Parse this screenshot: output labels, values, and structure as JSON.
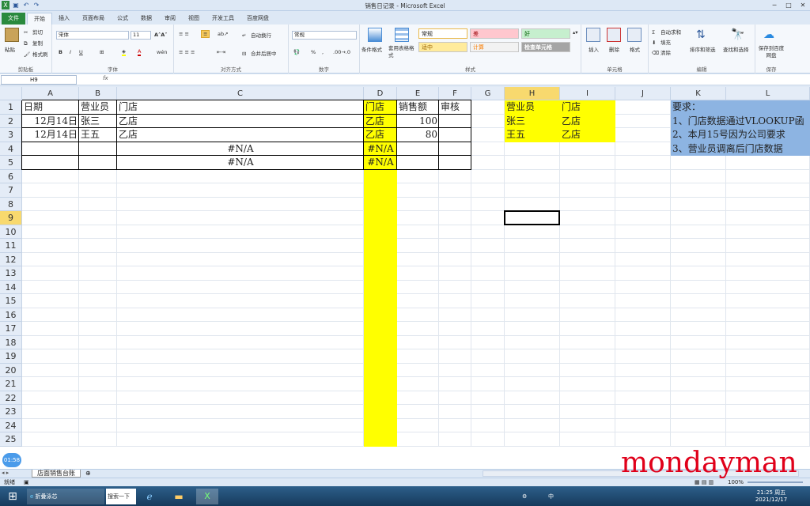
{
  "window": {
    "title": "销售日记录 - Microsoft Excel"
  },
  "tabs": [
    "文件",
    "开始",
    "插入",
    "页面布局",
    "公式",
    "数据",
    "审阅",
    "视图",
    "开发工具",
    "百度网盘"
  ],
  "ribbon": {
    "clipboard": {
      "label": "剪贴板",
      "paste": "粘贴",
      "cut": "剪切",
      "copy": "复制",
      "format_painter": "格式刷"
    },
    "font": {
      "label": "字体",
      "name": "宋体",
      "size": "11",
      "bold": "B",
      "italic": "I",
      "underline": "U"
    },
    "alignment": {
      "label": "对齐方式",
      "wrap": "自动换行",
      "merge": "合并后居中"
    },
    "number": {
      "label": "数字",
      "format": "常规",
      "percent": "%"
    },
    "styles": {
      "label": "样式",
      "conditional": "条件格式",
      "table": "套用表格格式",
      "cells": [
        "常规",
        "差",
        "好",
        "适中",
        "计算",
        "检查单元格"
      ]
    },
    "cells_group": {
      "label": "单元格",
      "insert": "插入",
      "delete": "删除",
      "format": "格式"
    },
    "editing": {
      "label": "编辑",
      "autosum": "自动求和",
      "fill": "填充",
      "clear": "清除",
      "sort": "排序和筛选",
      "find": "查找和选择"
    },
    "save": {
      "label": "保存",
      "baidu": "保存到百度网盘"
    }
  },
  "formula_bar": {
    "name_box": "H9",
    "fx": "fx",
    "content": ""
  },
  "columns": [
    "A",
    "B",
    "C",
    "D",
    "E",
    "F",
    "G",
    "H",
    "I",
    "J",
    "K",
    "L"
  ],
  "rows": [
    "1",
    "2",
    "3",
    "4",
    "5",
    "6",
    "7",
    "8",
    "9",
    "10",
    "11",
    "12",
    "13",
    "14",
    "15",
    "16",
    "17",
    "18",
    "19",
    "20",
    "21",
    "22",
    "23",
    "24",
    "25"
  ],
  "cells": {
    "A1": "日期",
    "B1": "营业员",
    "C1": "门店",
    "D1": "门店",
    "E1": "销售额",
    "F1": "审核",
    "A2": "12月14日",
    "B2": "张三",
    "C2": "乙店",
    "D2": "乙店",
    "E2": "100",
    "A3": "12月14日",
    "B3": "王五",
    "C3": "乙店",
    "D3": "乙店",
    "E3": "80",
    "C4": "#N/A",
    "D4": "#N/A",
    "C5": "#N/A",
    "D5": "#N/A",
    "H1": "营业员",
    "I1": "门店",
    "H2": "张三",
    "I2": "乙店",
    "H3": "王五",
    "I3": "乙店",
    "K1": "要求：",
    "K2": "1、门店数据通过VLOOKUP函",
    "K3": "2、本月15号因为公司要求",
    "K4": "3、营业员调离后门店数据"
  },
  "sheet_tab": "店面销售台账",
  "status": {
    "ready": "就绪",
    "zoom": "100%"
  },
  "taskbar": {
    "time": "21:25 周五",
    "date": "2021/12/17",
    "app1": "折叠泳芯",
    "search": "搜索一下",
    "lang": "中"
  },
  "overlay": {
    "timer": "01:58",
    "watermark": "mondayman"
  },
  "colors": {
    "yellow": "#ffff00",
    "blue_box": "#8db4e2",
    "excel_green": "#2a8a3e"
  }
}
